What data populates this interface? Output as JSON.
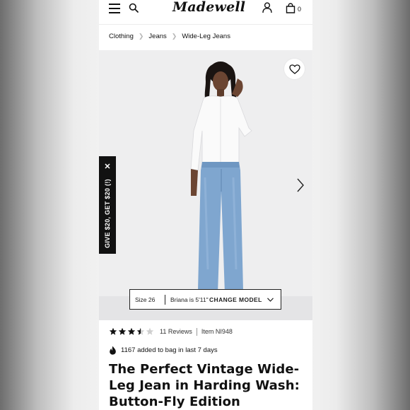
{
  "header": {
    "logo_text": "Madewell",
    "bag_count": "0",
    "icons": [
      "menu-icon",
      "search-icon",
      "account-icon",
      "shopping-bag-icon"
    ]
  },
  "breadcrumb": {
    "items": [
      "Clothing",
      "Jeans",
      "Wide-Leg Jeans"
    ]
  },
  "promo": {
    "label": "GIVE $20, GET $20 (!)",
    "close": "✕"
  },
  "model_bar": {
    "size": "Size 26",
    "model": "Briana is 5'11\"",
    "change_label": "CHANGE MODEL"
  },
  "rating": {
    "stars": 3.5,
    "max": 5,
    "reviews": "11 Reviews",
    "item": "Item NI948"
  },
  "social_proof": "1167 added to bag in last 7 days",
  "product": {
    "title": "The Perfect Vintage Wide-Leg Jean in Harding Wash: Button-Fly Edition"
  },
  "colors": {
    "accent": "#111111",
    "image_bg": "#eeeeef",
    "denim": "#7fa6cf"
  }
}
